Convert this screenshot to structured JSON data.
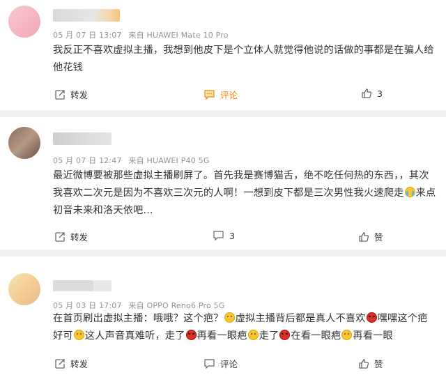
{
  "comments": [
    {
      "meta": {
        "date": "05 月 07 日 13:07",
        "source": "来自 HUAWEI Mate 10 Pro"
      },
      "text_lines": [
        "我反正不喜欢虚拟主播，我想到他皮下是个立体人就觉得他说的话做的事都是在骗人给",
        "他花钱"
      ],
      "actions": {
        "repost": "转发",
        "comment": "评论",
        "like": "3"
      }
    },
    {
      "meta": {
        "date": "05 月 07 日 12:47",
        "source": "来自 HUAWEI P40 5G"
      },
      "text_lines": [
        "最近微博要被那些虚拟主播刷屏了。首先我是赛博猫舌，绝不吃任何热的东西，，其次",
        "我喜欢二次元是因为不喜欢三次元的人啊！一想到皮下都是三次男性我火速爬走",
        "来点",
        "初音未来和洛天依吧..."
      ],
      "actions": {
        "repost": "转发",
        "comment": "3",
        "like": "赞"
      }
    },
    {
      "meta": {
        "date": "05 月 03 日 17:07",
        "source": "来自 OPPO Reno6 Pro 5G"
      },
      "text_parts": [
        "在首页刷出虚拟主播：哦哦？这个疤？",
        "虚拟主播背后都是真人不喜欢",
        "嘿嘿这个疤",
        "好可",
        "这人声音真难听，走了",
        "再看一眼疤",
        "走了",
        "在看一眼疤",
        "再看一眼"
      ],
      "actions": {
        "repost": "转发",
        "comment": "评论",
        "like": "赞"
      }
    }
  ],
  "colors": {
    "accent": "#ff8200",
    "text": "#333333",
    "meta": "#939393",
    "bg": "#f1f1f1"
  }
}
